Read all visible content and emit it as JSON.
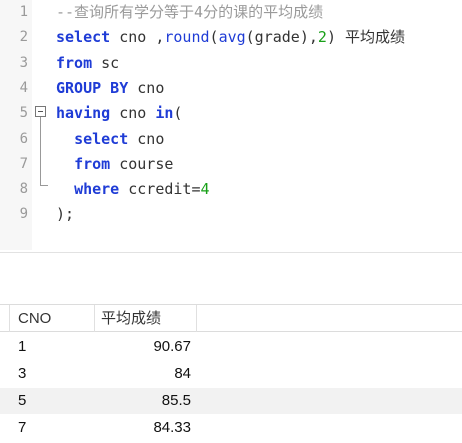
{
  "editor": {
    "line_numbers": [
      "1",
      "2",
      "3",
      "4",
      "5",
      "6",
      "7",
      "8",
      "9"
    ],
    "lines": [
      [
        {
          "t": "--查询所有学分等于4分的课的平均成绩",
          "c": "cm"
        }
      ],
      [
        {
          "t": "select",
          "c": "kw"
        },
        {
          "t": " cno ,",
          "c": "txt"
        },
        {
          "t": "round",
          "c": "fn"
        },
        {
          "t": "(",
          "c": "txt"
        },
        {
          "t": "avg",
          "c": "fn"
        },
        {
          "t": "(grade),",
          "c": "txt"
        },
        {
          "t": "2",
          "c": "num"
        },
        {
          "t": ") 平均成绩",
          "c": "txt"
        }
      ],
      [
        {
          "t": "from",
          "c": "kw"
        },
        {
          "t": " sc",
          "c": "txt"
        }
      ],
      [
        {
          "t": "GROUP BY",
          "c": "kw"
        },
        {
          "t": " cno",
          "c": "txt"
        }
      ],
      [
        {
          "t": "having",
          "c": "kw"
        },
        {
          "t": " cno ",
          "c": "txt"
        },
        {
          "t": "in",
          "c": "kw"
        },
        {
          "t": "(",
          "c": "txt"
        }
      ],
      [
        {
          "t": "  ",
          "c": "txt"
        },
        {
          "t": "select",
          "c": "kw"
        },
        {
          "t": " cno",
          "c": "txt"
        }
      ],
      [
        {
          "t": "  ",
          "c": "txt"
        },
        {
          "t": "from",
          "c": "kw"
        },
        {
          "t": " course",
          "c": "txt"
        }
      ],
      [
        {
          "t": "  ",
          "c": "txt"
        },
        {
          "t": "where",
          "c": "kw"
        },
        {
          "t": " ccredit=",
          "c": "txt"
        },
        {
          "t": "4",
          "c": "num"
        }
      ],
      [
        {
          "t": ");",
          "c": "txt"
        }
      ]
    ]
  },
  "result": {
    "columns": [
      "CNO",
      "平均成绩"
    ],
    "rows": [
      [
        "1",
        "90.67"
      ],
      [
        "3",
        "84"
      ],
      [
        "5",
        "85.5"
      ],
      [
        "7",
        "84.33"
      ]
    ]
  }
}
